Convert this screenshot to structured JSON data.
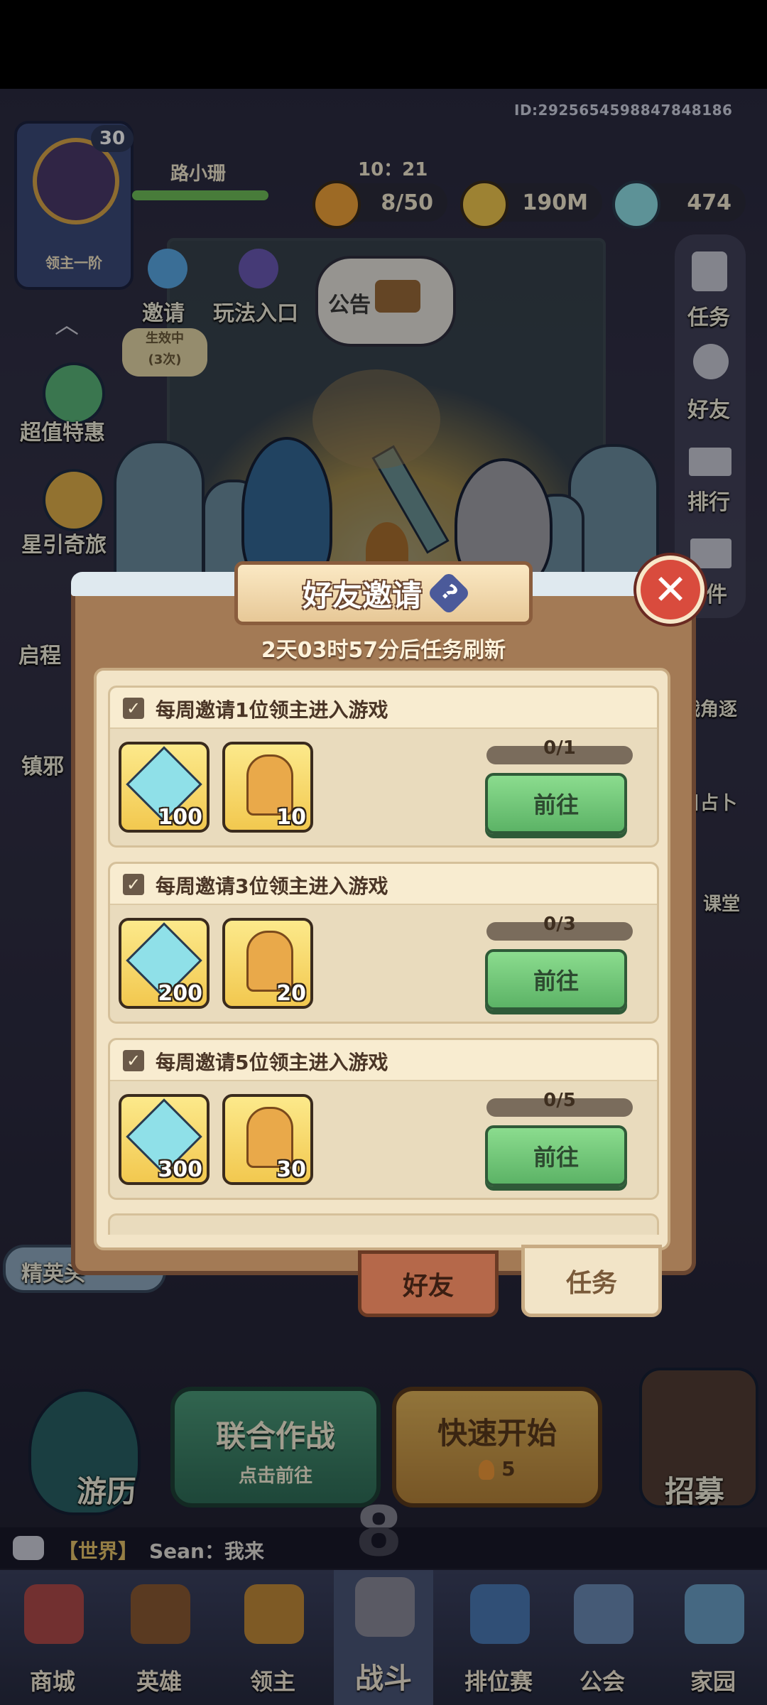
{
  "header": {
    "uid": "ID:2925654598847848186",
    "player_name": "路小珊",
    "level": "30",
    "rank": "领主一阶",
    "clock": "10：21"
  },
  "resources": {
    "stamina": "8/50",
    "gold": "190M",
    "crystal": "474"
  },
  "top_menu": {
    "invite": "邀请",
    "gameplay": "玩法入口",
    "notice": "公告"
  },
  "left_menu": {
    "effect_badge": "生效中",
    "effect_count": "(3次)",
    "value_deal": "超值特惠",
    "star_journey": "星引奇旅",
    "item3": "启程",
    "item4": "镇邪"
  },
  "right_menu": {
    "tasks": "任务",
    "friends": "好友",
    "ranking": "排行",
    "mail": "件",
    "item5": "战角逐",
    "item6": "日占卜",
    "item7": "课堂"
  },
  "dialog": {
    "title": "好友邀请",
    "help_icon": "?",
    "close_icon": "✕",
    "refresh_text": "2天03时57分后任务刷新",
    "tasks": [
      {
        "title": "每周邀请1位领主进入游戏",
        "crystal": "100",
        "key": "10",
        "progress": "0/1",
        "ratio": 0,
        "button": "前往"
      },
      {
        "title": "每周邀请3位领主进入游戏",
        "crystal": "200",
        "key": "20",
        "progress": "0/3",
        "ratio": 0,
        "button": "前往"
      },
      {
        "title": "每周邀请5位领主进入游戏",
        "crystal": "300",
        "key": "30",
        "progress": "0/5",
        "ratio": 0,
        "button": "前往"
      }
    ],
    "tabs": {
      "friends": "好友",
      "tasks": "任务"
    }
  },
  "lower": {
    "elite": "精英头",
    "coop_title": "联合作战",
    "coop_sub": "点击前往",
    "quick_title": "快速开始",
    "quick_cost": "5",
    "travel": "游历",
    "recruit": "招募",
    "stage": "8"
  },
  "chat": {
    "channel": "【世界】",
    "message": "Sean：我来"
  },
  "nav": {
    "shop": "商城",
    "hero": "英雄",
    "lord": "领主",
    "battle": "战斗",
    "ranked": "排位赛",
    "guild": "公会",
    "home": "家园"
  },
  "colors": {
    "accent_green": "#5cb366",
    "close_red": "#d94b3d",
    "parchment": "#f2e4c7",
    "wood": "#a37a55"
  }
}
